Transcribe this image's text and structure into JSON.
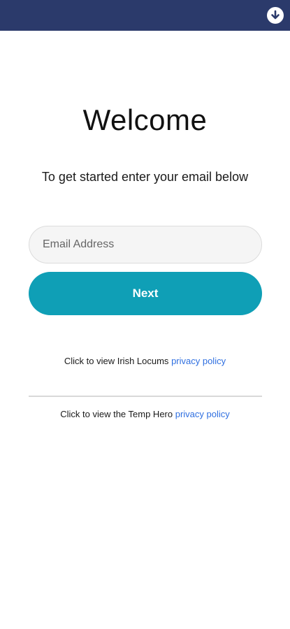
{
  "header": {
    "download_icon": "download-arrow-icon",
    "bar_color": "#2b3a6b"
  },
  "welcome": {
    "title": "Welcome",
    "subtitle": "To get started enter your email below"
  },
  "form": {
    "email_placeholder": "Email Address",
    "email_value": "",
    "next_label": "Next",
    "accent_color": "#0f9fb6"
  },
  "policies": {
    "irish_locums_text": "Click to view Irish Locums",
    "irish_locums_link": "privacy policy",
    "temp_hero_text": "Click to view the Temp Hero",
    "temp_hero_link": "privacy policy",
    "link_color": "#2f6fe0"
  }
}
